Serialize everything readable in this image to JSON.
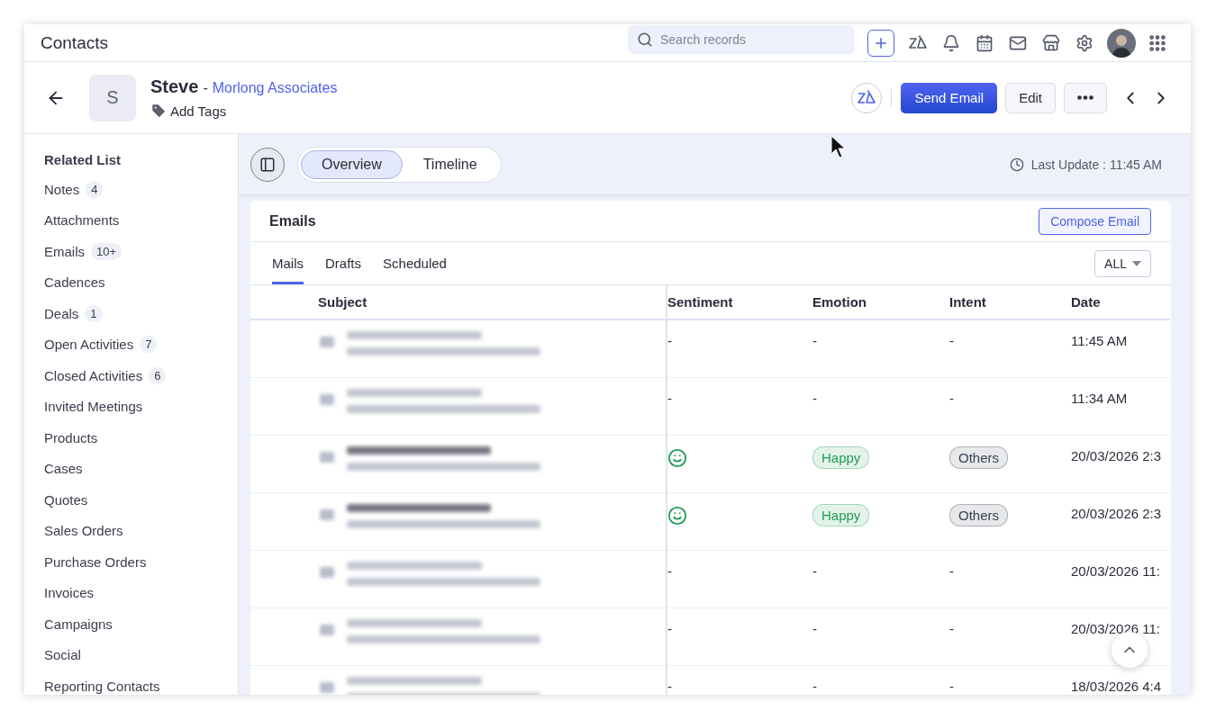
{
  "topbar": {
    "title": "Contacts",
    "search": {
      "placeholder": "Search records"
    }
  },
  "record": {
    "avatar_letter": "S",
    "name": "Steve",
    "separator": "-",
    "company": "Morlong Associates",
    "add_tags": "Add Tags",
    "send": "Send Email",
    "edit": "Edit"
  },
  "sidebar": {
    "title": "Related List",
    "items": [
      {
        "label": "Notes",
        "count": "4"
      },
      {
        "label": "Attachments"
      },
      {
        "label": "Emails",
        "count": "10+"
      },
      {
        "label": "Cadences"
      },
      {
        "label": "Deals",
        "count": "1"
      },
      {
        "label": "Open Activities",
        "count": "7"
      },
      {
        "label": "Closed Activities",
        "count": "6"
      },
      {
        "label": "Invited Meetings"
      },
      {
        "label": "Products"
      },
      {
        "label": "Cases"
      },
      {
        "label": "Quotes"
      },
      {
        "label": "Sales Orders"
      },
      {
        "label": "Purchase Orders"
      },
      {
        "label": "Invoices"
      },
      {
        "label": "Campaigns"
      },
      {
        "label": "Social"
      },
      {
        "label": "Reporting Contacts"
      }
    ]
  },
  "view_tabs": [
    {
      "label": "Overview",
      "selected": true
    },
    {
      "label": "Timeline",
      "selected": false
    }
  ],
  "last_update": "Last Update : 11:45 AM",
  "emails": {
    "title": "Emails",
    "compose": "Compose Email",
    "filter": "ALL",
    "tabs": [
      {
        "label": "Mails",
        "selected": true
      },
      {
        "label": "Drafts",
        "selected": false
      },
      {
        "label": "Scheduled",
        "selected": false
      }
    ],
    "columns": [
      "Subject",
      "Sentiment",
      "Emotion",
      "Intent",
      "Date"
    ],
    "rows": [
      {
        "subject": {
          "bold": false
        },
        "sentiment": {
          "kind": "text",
          "text": "-"
        },
        "emotion": {
          "kind": "text",
          "text": "-"
        },
        "intent": {
          "kind": "text",
          "text": "-"
        },
        "date": "11:45 AM"
      },
      {
        "subject": {
          "bold": false
        },
        "sentiment": {
          "kind": "text",
          "text": "-"
        },
        "emotion": {
          "kind": "text",
          "text": "-"
        },
        "intent": {
          "kind": "text",
          "text": "-"
        },
        "date": "11:34 AM"
      },
      {
        "subject": {
          "bold": true
        },
        "sentiment": {
          "kind": "smile"
        },
        "emotion": {
          "kind": "tag",
          "text": "Happy",
          "color": "#1f9d55"
        },
        "intent": {
          "kind": "tag",
          "text": "Others",
          "color": "#3b3f55"
        },
        "date": "20/03/2026 2:3"
      },
      {
        "subject": {
          "bold": true
        },
        "sentiment": {
          "kind": "smile"
        },
        "emotion": {
          "kind": "tag",
          "text": "Happy",
          "color": "#1f9d55"
        },
        "intent": {
          "kind": "tag",
          "text": "Others",
          "color": "#3b3f55"
        },
        "date": "20/03/2026 2:3"
      },
      {
        "subject": {
          "bold": false
        },
        "sentiment": {
          "kind": "text",
          "text": "-"
        },
        "emotion": {
          "kind": "text",
          "text": "-"
        },
        "intent": {
          "kind": "text",
          "text": "-"
        },
        "date": "20/03/2026 11:"
      },
      {
        "subject": {
          "bold": false
        },
        "sentiment": {
          "kind": "text",
          "text": "-"
        },
        "emotion": {
          "kind": "text",
          "text": "-"
        },
        "intent": {
          "kind": "text",
          "text": "-"
        },
        "date": "20/03/2026 11:"
      },
      {
        "subject": {
          "bold": false
        },
        "sentiment": {
          "kind": "text",
          "text": "-"
        },
        "emotion": {
          "kind": "text",
          "text": "-"
        },
        "intent": {
          "kind": "text",
          "text": "-"
        },
        "date": "18/03/2026 4:4"
      }
    ]
  }
}
